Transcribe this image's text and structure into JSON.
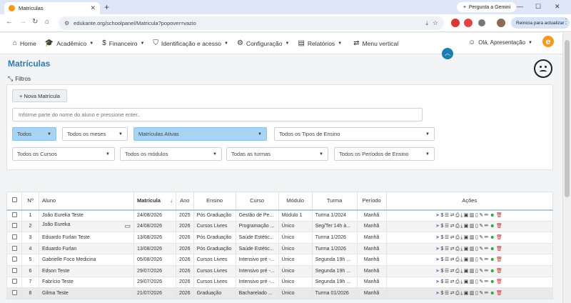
{
  "browser": {
    "tab_title": "Matrículas",
    "new_tab": "+",
    "gemini_label": "Pergunta a Gemini",
    "url": "edukante.org/schoolpanel/Matricula?popover=vazio",
    "update_label": "Reinicia para actualizar"
  },
  "nav": {
    "items": [
      {
        "label": "Home",
        "icon": "home-icon",
        "caret": false
      },
      {
        "label": "Acadêmico",
        "icon": "graduation-icon",
        "caret": true
      },
      {
        "label": "Financeiro",
        "icon": "money-icon",
        "caret": true
      },
      {
        "label": "Identificação e acesso",
        "icon": "shield-icon",
        "caret": true
      },
      {
        "label": "Configuração",
        "icon": "gear-icon",
        "caret": true
      },
      {
        "label": "Relatórios",
        "icon": "report-icon",
        "caret": true
      },
      {
        "label": "Menu vertical",
        "icon": "arrows-icon",
        "caret": false
      }
    ],
    "user": "Olá, Apresentação",
    "brand": "e"
  },
  "page": {
    "title": "Matrículas",
    "filters_label": "Filtros",
    "new_button": "+ Nova Matrícula",
    "search_placeholder": "Informe parte do nome do aluno e pressione enter..",
    "filters_row1": [
      "Todos",
      "Todos os meses",
      "Matrículas Ativas",
      "Todos os Tipos de Ensino"
    ],
    "filters_row2": [
      "Todos os Cursos",
      "Todos os módulos",
      "Todas as turmas",
      "Todos os Períodos de Ensino"
    ],
    "active_color": "#a7d4f3"
  },
  "table": {
    "headers": [
      "Nº",
      "Aluno",
      "Matrícula",
      "Ano",
      "Ensino",
      "Curso",
      "Módulo",
      "Turma",
      "Período",
      "Ações"
    ],
    "rows": [
      [
        "1",
        "João Eureka Teste",
        "24/08/2026",
        "2025",
        "Pós Graduação",
        "Gestão de Pe...",
        "Módulo 1",
        "Turma 1/2024",
        "Manhã"
      ],
      [
        "2",
        "João Eureka",
        "24/08/2026",
        "2026",
        "Cursos Livres",
        "Programação ...",
        "Único",
        "Seg/Ter 14h à...",
        "Manhã"
      ],
      [
        "3",
        "Eduardo Furlan Teste",
        "13/08/2026",
        "2026",
        "Pós Graduação",
        "Saúde Estétic...",
        "Único",
        "Turma 1/2026",
        "Manhã"
      ],
      [
        "4",
        "Eduardo Furlan",
        "13/08/2026",
        "2026",
        "Pós Graduação",
        "Saúde Estétic...",
        "Único",
        "Turma 1/2026",
        "Manhã"
      ],
      [
        "5",
        "Gabrielle Foco Medicina",
        "05/08/2026",
        "2026",
        "Cursos Livres",
        "Intensivo pré -...",
        "Único",
        "Segunda 19h ...",
        "Manhã"
      ],
      [
        "6",
        "Edson Teste",
        "29/07/2026",
        "2026",
        "Cursos Livres",
        "Intensivo pré -...",
        "Único",
        "Segunda 19h ...",
        "Manhã"
      ],
      [
        "7",
        "Fabrício Teste",
        "29/07/2026",
        "2026",
        "Cursos Livres",
        "Intensivo pré -...",
        "Único",
        "Segunda 19h ...",
        "Manhã"
      ],
      [
        "8",
        "Gilma Teste",
        "21/07/2026",
        "2026",
        "Graduação",
        "Bacharelado ...",
        "Único",
        "Turma 01/2026",
        "Manhã"
      ]
    ]
  }
}
